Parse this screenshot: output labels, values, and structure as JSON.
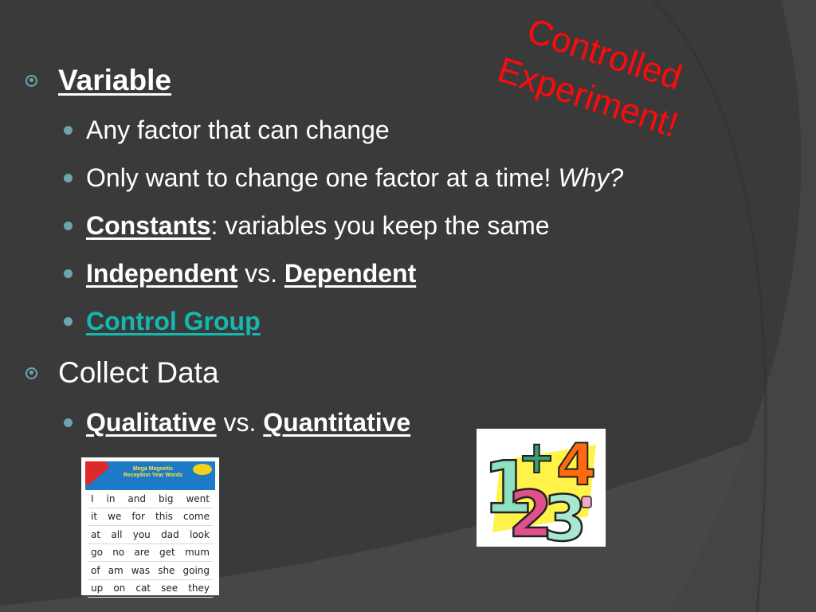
{
  "callout": {
    "line1": "Controlled",
    "line2": "Experiment!",
    "color": "#ff0a0a"
  },
  "sections": [
    {
      "heading": "Variable",
      "items": [
        {
          "text": "Any factor that can change"
        },
        {
          "text": "Only want to change one factor at a time! ",
          "emphasis": "Why?"
        },
        {
          "term": "Constants",
          "rest": ": variables you keep the same"
        },
        {
          "term1": "Independent",
          "sep": " vs. ",
          "term2": "Dependent"
        },
        {
          "term": "Control Group"
        }
      ]
    },
    {
      "heading": "Collect Data",
      "items": [
        {
          "term1": "Qualitative",
          "sep": " vs. ",
          "term2": "Quantitative"
        }
      ]
    }
  ],
  "images": {
    "magnets": {
      "title_line1": "Mega Magnetic",
      "title_line2": "Reception Year Words",
      "words": [
        [
          "I",
          "in",
          "and",
          "big",
          "went"
        ],
        [
          "it",
          "we",
          "for",
          "this",
          "come"
        ],
        [
          "at",
          "all",
          "you",
          "dad",
          "look"
        ],
        [
          "go",
          "no",
          "are",
          "get",
          "mum"
        ],
        [
          "of",
          "am",
          "was",
          "she",
          "going"
        ],
        [
          "up",
          "on",
          "cat",
          "see",
          "they"
        ]
      ]
    },
    "numbers": {
      "glyphs": [
        "1",
        "+",
        "4",
        "2",
        "3"
      ]
    }
  },
  "colors": {
    "background": "#3a3a3a",
    "bullet": "#6fa3b3",
    "accent_teal": "#14b8b0"
  }
}
